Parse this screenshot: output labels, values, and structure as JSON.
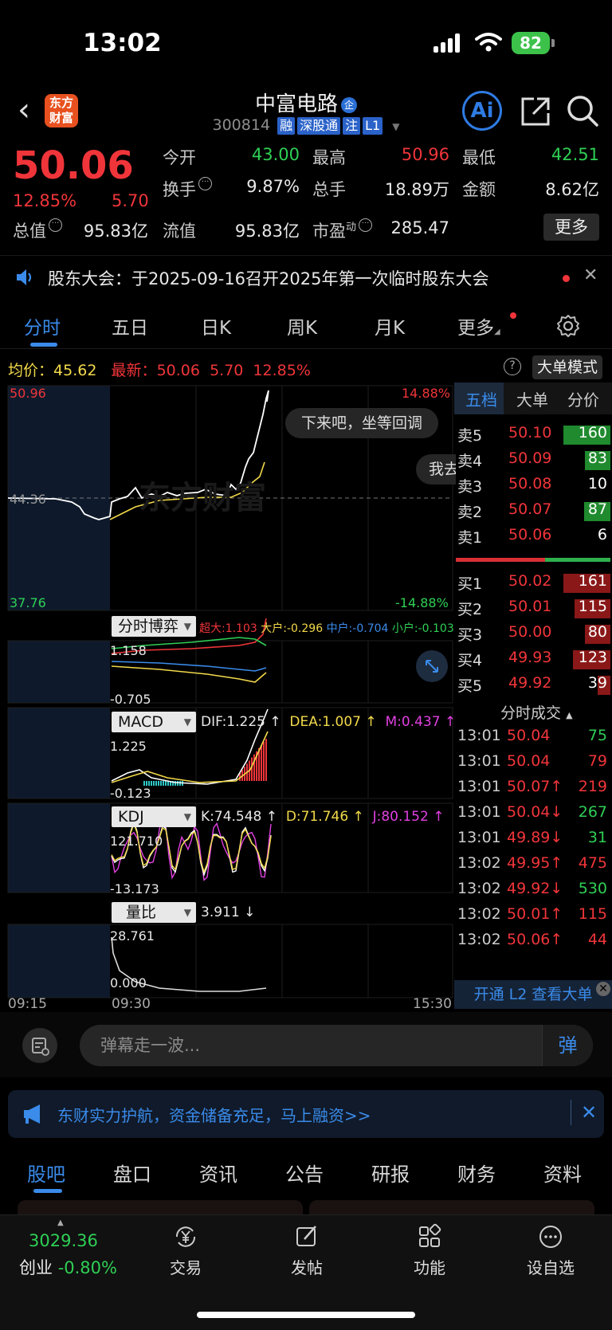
{
  "status_bar": {
    "time": "13:02",
    "battery": "82"
  },
  "header": {
    "logo_line1": "东方",
    "logo_line2": "财富",
    "stock_name": "中富电路",
    "name_badge": "企",
    "stock_code": "300814",
    "tags": [
      "融",
      "深股通",
      "注",
      "L1"
    ],
    "ai_label": "Ai"
  },
  "quote": {
    "price": "50.06",
    "change_pct": "12.85%",
    "change": "5.70",
    "fields": [
      {
        "label": "今开",
        "value": "43.00",
        "color": "green"
      },
      {
        "label": "最高",
        "value": "50.96",
        "color": "red"
      },
      {
        "label": "最低",
        "value": "42.51",
        "color": "green"
      },
      {
        "label": "换手",
        "value": "9.87%",
        "color": "white"
      },
      {
        "label": "总手",
        "value": "18.89万",
        "color": "white"
      },
      {
        "label": "金额",
        "value": "8.62亿",
        "color": "white"
      },
      {
        "label": "总值",
        "value": "95.83亿",
        "color": "white"
      },
      {
        "label": "流值",
        "value": "95.83亿",
        "color": "white"
      },
      {
        "label": "市盈",
        "sup": "动",
        "value": "285.47",
        "color": "white"
      }
    ],
    "more_label": "更多"
  },
  "notice": {
    "text": "股东大会：于2025-09-16召开2025年第一次临时股东大会"
  },
  "chart_tabs": [
    {
      "label": "分时",
      "active": true
    },
    {
      "label": "五日"
    },
    {
      "label": "日K"
    },
    {
      "label": "周K"
    },
    {
      "label": "月K"
    },
    {
      "label": "更多"
    }
  ],
  "avg_row": {
    "avg_label": "均价：",
    "avg_value": "45.62",
    "latest_label": "最新：",
    "latest_value": "50.06",
    "change": "5.70",
    "pct": "12.85%",
    "bigmode_label": "大单模式",
    "help": "?"
  },
  "intraday": {
    "high_label": "50.96",
    "low_label": "37.76",
    "mid_label": "44.36",
    "high_pct": "14.88%",
    "low_pct": "-14.88%",
    "bubble1": "下来吧，坐等回调",
    "bubble2": "我去",
    "watermark": "东方财富",
    "time_start": "09:15",
    "time_open": "09:30",
    "time_end": "15:30"
  },
  "indicators": {
    "game": {
      "selector": "分时博弈",
      "super": "超大:1.103",
      "big": "大户:-0.296",
      "mid": "中户:-0.704",
      "small": "小户:-0.103",
      "axis_top": "1.158",
      "axis_bottom": "-0.705"
    },
    "macd": {
      "selector": "MACD",
      "dif": "DIF:1.225 ↑",
      "dea": "DEA:1.007 ↑",
      "m": "M:0.437 ↑",
      "axis_top": "1.225",
      "axis_bottom": "-0.123"
    },
    "kdj": {
      "selector": "KDJ",
      "k": "K:74.548 ↑",
      "d": "D:71.746 ↑",
      "j": "J:80.152 ↑",
      "axis_top": "121.710",
      "axis_bottom": "-13.173"
    },
    "volratio": {
      "selector": "量比",
      "value": "3.911 ↓",
      "axis_top": "28.761",
      "axis_bottom": "0.000"
    }
  },
  "order_book": {
    "tabs": [
      "五档",
      "大单",
      "分价"
    ],
    "asks": [
      {
        "label": "卖5",
        "price": "50.10",
        "vol": "160",
        "bar": 0.92,
        "barcolor": "green"
      },
      {
        "label": "卖4",
        "price": "50.09",
        "vol": "83",
        "bar": 0.5,
        "barcolor": "green"
      },
      {
        "label": "卖3",
        "price": "50.08",
        "vol": "10",
        "bar": 0,
        "barcolor": "green"
      },
      {
        "label": "卖2",
        "price": "50.07",
        "vol": "87",
        "bar": 0.52,
        "barcolor": "green"
      },
      {
        "label": "卖1",
        "price": "50.06",
        "vol": "6",
        "bar": 0,
        "barcolor": "green"
      }
    ],
    "bids": [
      {
        "label": "买1",
        "price": "50.02",
        "vol": "161",
        "bar": 0.92,
        "barcolor": "red"
      },
      {
        "label": "买2",
        "price": "50.01",
        "vol": "115",
        "bar": 0.7,
        "barcolor": "red"
      },
      {
        "label": "买3",
        "price": "50.00",
        "vol": "80",
        "bar": 0.5,
        "barcolor": "red"
      },
      {
        "label": "买4",
        "price": "49.93",
        "vol": "123",
        "bar": 0.74,
        "barcolor": "red"
      },
      {
        "label": "买5",
        "price": "49.92",
        "vol": "39",
        "bar": 0.25,
        "barcolor": "red"
      }
    ],
    "trades_title": "分时成交",
    "trades": [
      {
        "time": "13:01",
        "price": "50.04",
        "dir": "",
        "vol": "75",
        "pcolor": "red",
        "vcolor": "green"
      },
      {
        "time": "13:01",
        "price": "50.04",
        "dir": "",
        "vol": "79",
        "pcolor": "red",
        "vcolor": "red"
      },
      {
        "time": "13:01",
        "price": "50.07",
        "dir": "↑",
        "vol": "219",
        "pcolor": "red",
        "vcolor": "red"
      },
      {
        "time": "13:01",
        "price": "50.04",
        "dir": "↓",
        "vol": "267",
        "pcolor": "red",
        "vcolor": "green"
      },
      {
        "time": "13:01",
        "price": "49.89",
        "dir": "↓",
        "vol": "31",
        "pcolor": "red",
        "vcolor": "green"
      },
      {
        "time": "13:02",
        "price": "49.95",
        "dir": "↑",
        "vol": "475",
        "pcolor": "red",
        "vcolor": "red"
      },
      {
        "time": "13:02",
        "price": "49.92",
        "dir": "↓",
        "vol": "530",
        "pcolor": "red",
        "vcolor": "green"
      },
      {
        "time": "13:02",
        "price": "50.01",
        "dir": "↑",
        "vol": "115",
        "pcolor": "red",
        "vcolor": "red"
      },
      {
        "time": "13:02",
        "price": "50.06",
        "dir": "↑",
        "vol": "44",
        "pcolor": "red",
        "vcolor": "red"
      }
    ],
    "l2_label": "开通 L2 查看大单"
  },
  "danmu": {
    "placeholder": "弹幕走一波...",
    "send": "弹"
  },
  "promo": {
    "text": "东财实力护航，资金储备充足，马上融资>>"
  },
  "sub_tabs": [
    "股吧",
    "盘口",
    "资讯",
    "公告",
    "研报",
    "财务",
    "资料"
  ],
  "bottom_nav": {
    "index_value": "3029.36",
    "index_name": "创业",
    "index_change": "-0.80%",
    "items": [
      {
        "label": "交易",
        "icon": "trade-icon"
      },
      {
        "label": "发帖",
        "icon": "post-icon"
      },
      {
        "label": "功能",
        "icon": "apps-icon"
      },
      {
        "label": "设自选",
        "icon": "watchlist-icon"
      }
    ]
  }
}
